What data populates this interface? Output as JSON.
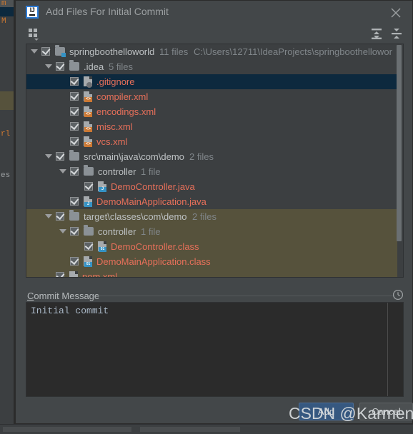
{
  "dialog": {
    "title": "Add Files For Initial Commit",
    "app_icon": "intellij-idea-icon",
    "close_icon": "close-icon"
  },
  "toolbar": {
    "group_by_directory_icon": "group-by-directory-icon",
    "expand_all_icon": "expand-all-icon",
    "collapse_all_icon": "collapse-all-icon"
  },
  "tree": {
    "rows": [
      {
        "name": "springboothelloworld",
        "meta": "11 files",
        "path": "C:\\Users\\12711\\IdeaProjects\\springboothellowor",
        "type": "module",
        "icon": "module-folder-icon",
        "depth": 0,
        "expanded": true,
        "checked": true,
        "selected": false,
        "ignored": false
      },
      {
        "name": ".idea",
        "meta": "5 files",
        "path": "",
        "type": "folder",
        "icon": "folder-icon",
        "depth": 1,
        "expanded": true,
        "checked": true,
        "selected": false,
        "ignored": false
      },
      {
        "name": ".gitignore",
        "meta": "",
        "path": "",
        "type": "file",
        "icon": "gitignore-file-icon",
        "depth": 2,
        "expanded": null,
        "checked": true,
        "selected": true,
        "ignored": false
      },
      {
        "name": "compiler.xml",
        "meta": "",
        "path": "",
        "type": "file",
        "icon": "xml-file-icon",
        "depth": 2,
        "expanded": null,
        "checked": true,
        "selected": false,
        "ignored": false
      },
      {
        "name": "encodings.xml",
        "meta": "",
        "path": "",
        "type": "file",
        "icon": "xml-file-icon",
        "depth": 2,
        "expanded": null,
        "checked": true,
        "selected": false,
        "ignored": false
      },
      {
        "name": "misc.xml",
        "meta": "",
        "path": "",
        "type": "file",
        "icon": "xml-file-icon",
        "depth": 2,
        "expanded": null,
        "checked": true,
        "selected": false,
        "ignored": false
      },
      {
        "name": "vcs.xml",
        "meta": "",
        "path": "",
        "type": "file",
        "icon": "xml-file-icon",
        "depth": 2,
        "expanded": null,
        "checked": true,
        "selected": false,
        "ignored": false
      },
      {
        "name": "src\\main\\java\\com\\demo",
        "meta": "2 files",
        "path": "",
        "type": "folder",
        "icon": "folder-icon",
        "depth": 1,
        "expanded": true,
        "checked": true,
        "selected": false,
        "ignored": false
      },
      {
        "name": "controller",
        "meta": "1 file",
        "path": "",
        "type": "folder",
        "icon": "folder-icon",
        "depth": 2,
        "expanded": true,
        "checked": true,
        "selected": false,
        "ignored": false
      },
      {
        "name": "DemoController.java",
        "meta": "",
        "path": "",
        "type": "file",
        "icon": "java-file-icon",
        "depth": 3,
        "expanded": null,
        "checked": true,
        "selected": false,
        "ignored": false
      },
      {
        "name": "DemoMainApplication.java",
        "meta": "",
        "path": "",
        "type": "file",
        "icon": "java-file-icon",
        "depth": 2,
        "expanded": null,
        "checked": true,
        "selected": false,
        "ignored": false
      },
      {
        "name": "target\\classes\\com\\demo",
        "meta": "2 files",
        "path": "",
        "type": "folder",
        "icon": "folder-icon",
        "depth": 1,
        "expanded": true,
        "checked": true,
        "selected": false,
        "ignored": true
      },
      {
        "name": "controller",
        "meta": "1 file",
        "path": "",
        "type": "folder",
        "icon": "folder-icon",
        "depth": 2,
        "expanded": true,
        "checked": true,
        "selected": false,
        "ignored": true
      },
      {
        "name": "DemoController.class",
        "meta": "",
        "path": "",
        "type": "file",
        "icon": "class-file-icon",
        "depth": 3,
        "expanded": null,
        "checked": true,
        "selected": false,
        "ignored": true
      },
      {
        "name": "DemoMainApplication.class",
        "meta": "",
        "path": "",
        "type": "file",
        "icon": "class-file-icon",
        "depth": 2,
        "expanded": null,
        "checked": true,
        "selected": false,
        "ignored": true
      },
      {
        "name": "pom.xml",
        "meta": "",
        "path": "",
        "type": "file",
        "icon": "xml-file-icon",
        "depth": 1,
        "expanded": null,
        "checked": true,
        "selected": false,
        "ignored": true
      }
    ]
  },
  "commit": {
    "label_mnemonic": "C",
    "label_rest": "ommit Message",
    "history_icon": "history-clock-icon",
    "message": "Initial commit",
    "placeholder": ""
  },
  "buttons": {
    "add": "Add",
    "cancel": "Cancel"
  },
  "watermark": {
    "text": "CSDN @Karmen_"
  },
  "background": {
    "fragments": [
      "m",
      "M",
      "rl",
      "es"
    ]
  },
  "colors": {
    "dialog_bg": "#434749",
    "tree_bg": "#3c3f41",
    "selection": "#0d293e",
    "ignored_row": "#56523c",
    "file_red": "#e8705a",
    "accent_blue": "#365880",
    "xml_badge": "#cc7832",
    "java_badge": "#3592c4"
  }
}
